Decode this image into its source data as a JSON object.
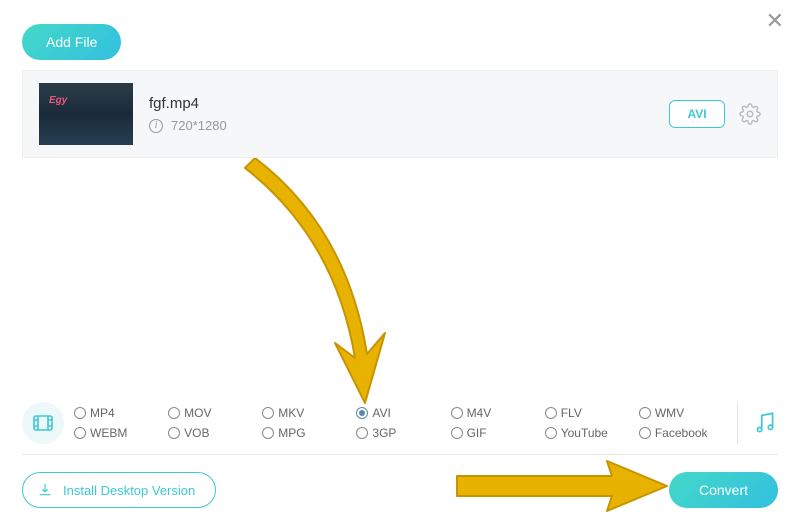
{
  "close_glyph": "✕",
  "add_file_label": "Add File",
  "file": {
    "name": "fgf.mp4",
    "resolution": "720*1280",
    "thumb_tag": "Egy",
    "selected_format": "AVI"
  },
  "formats": {
    "row1": [
      "MP4",
      "MOV",
      "MKV",
      "AVI",
      "M4V",
      "FLV",
      "WMV"
    ],
    "row2": [
      "WEBM",
      "VOB",
      "MPG",
      "3GP",
      "GIF",
      "YouTube",
      "Facebook"
    ],
    "selected": "AVI"
  },
  "install_label": "Install Desktop Version",
  "convert_label": "Convert"
}
